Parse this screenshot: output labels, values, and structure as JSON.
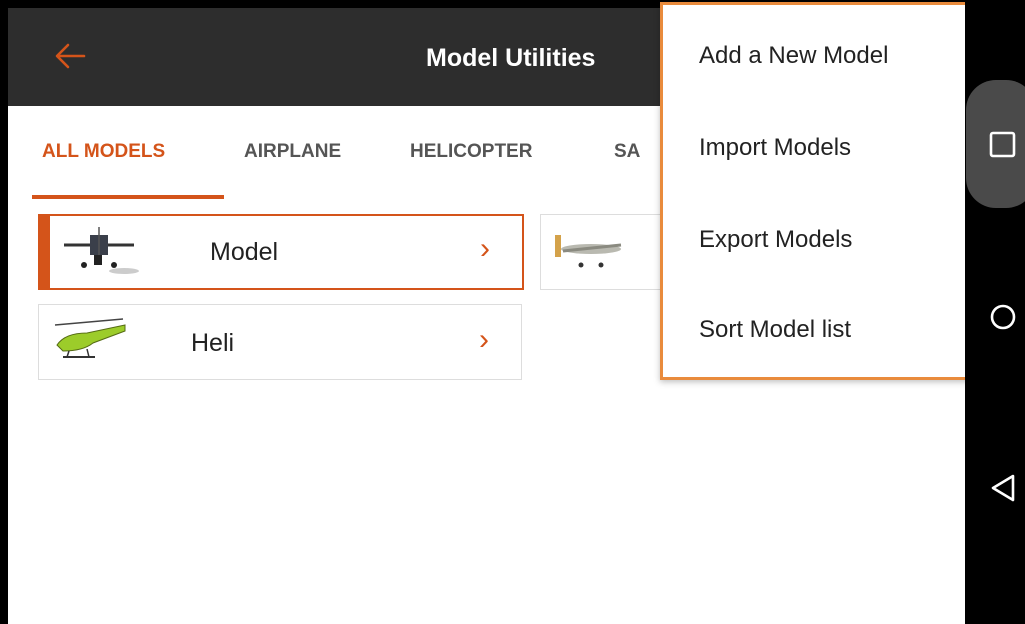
{
  "app": {
    "title": "Model Utilities",
    "back_icon": "arrow-left-icon"
  },
  "tabs": [
    {
      "label": "ALL MODELS",
      "active": true
    },
    {
      "label": "AIRPLANE",
      "active": false
    },
    {
      "label": "HELICOPTER",
      "active": false
    },
    {
      "label": "SA",
      "active": false
    }
  ],
  "models": [
    {
      "name": "Model",
      "selected": true,
      "thumb": "warbird-plane-thumbnail"
    },
    {
      "name": "Heli",
      "selected": false,
      "thumb": "helicopter-thumbnail"
    },
    {
      "name": "",
      "selected": false,
      "thumb": "plane-thumbnail"
    }
  ],
  "menu": {
    "items": [
      "Add a New Model",
      "Import Models",
      "Export Models",
      "Sort Model list"
    ]
  },
  "navbar": {
    "icons": [
      "square-icon",
      "circle-icon",
      "triangle-back-icon"
    ]
  },
  "colors": {
    "accent": "#d4541a",
    "appbar": "#2d2d2d",
    "highlight": "#e98b3c"
  }
}
